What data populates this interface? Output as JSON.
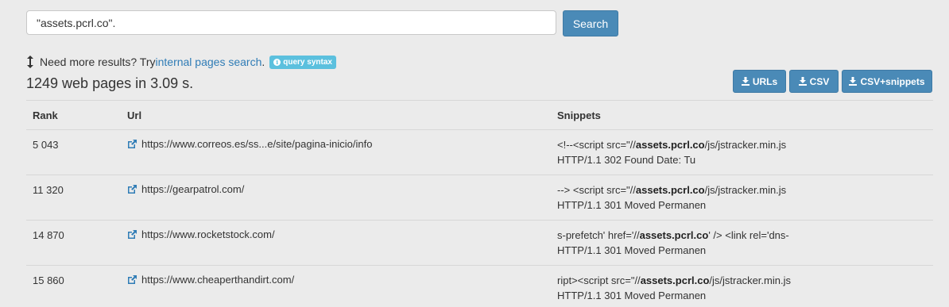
{
  "search": {
    "value": "\"assets.pcrl.co\".",
    "button_label": "Search"
  },
  "more_results": {
    "prefix": "Need more results? Try ",
    "link_label": "internal pages search",
    "suffix": ".",
    "badge_label": "query syntax"
  },
  "results_count": "1249 web pages in 3.09 s.",
  "downloads": [
    {
      "label": "URLs"
    },
    {
      "label": "CSV"
    },
    {
      "label": "CSV+snippets"
    }
  ],
  "table": {
    "headers": {
      "rank": "Rank",
      "url": "Url",
      "snippets": "Snippets"
    },
    "rows": [
      {
        "rank": "5 043",
        "url": "https://www.correos.es/ss...e/site/pagina-inicio/info",
        "snippet_pre": "<!--<script src=\"//",
        "snippet_bold": "assets.pcrl.co",
        "snippet_post": "/js/jstracker.min.js",
        "snippet_line2": "HTTP/1.1 302 Found Date: Tu"
      },
      {
        "rank": "11 320",
        "url": "https://gearpatrol.com/",
        "snippet_pre": "--> <script src=\"//",
        "snippet_bold": "assets.pcrl.co",
        "snippet_post": "/js/jstracker.min.js",
        "snippet_line2": "HTTP/1.1 301 Moved Permanen"
      },
      {
        "rank": "14 870",
        "url": "https://www.rocketstock.com/",
        "snippet_pre": "s-prefetch' href='//",
        "snippet_bold": "assets.pcrl.co",
        "snippet_post": "' /> <link rel='dns-",
        "snippet_line2": "HTTP/1.1 301 Moved Permanen"
      },
      {
        "rank": "15 860",
        "url": "https://www.cheaperthandirt.com/",
        "snippet_pre": "ript><script src=\"//",
        "snippet_bold": "assets.pcrl.co",
        "snippet_post": "/js/jstracker.min.js",
        "snippet_line2": "HTTP/1.1 301 Moved Permanen"
      }
    ]
  },
  "colors": {
    "primary_button": "#4a8ab7",
    "link": "#2f7cb6",
    "badge": "#5bc0de",
    "background": "#ebebeb"
  },
  "icons": [
    "updown-arrow-icon",
    "info-icon",
    "download-icon",
    "external-link-icon"
  ]
}
